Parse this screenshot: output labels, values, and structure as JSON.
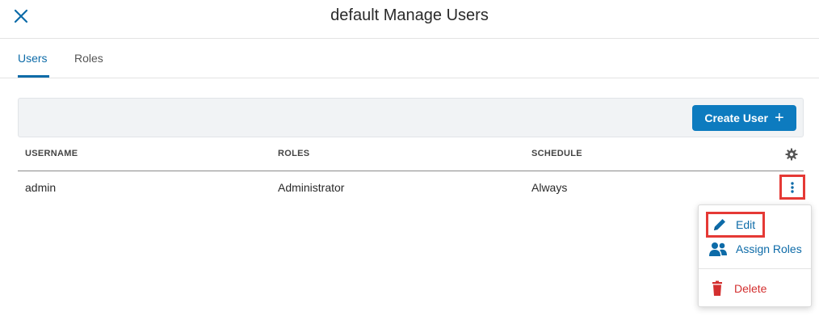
{
  "header": {
    "title": "default Manage Users",
    "close_icon": "close-icon"
  },
  "tabs": [
    {
      "label": "Users",
      "active": true
    },
    {
      "label": "Roles",
      "active": false
    }
  ],
  "toolbar": {
    "create_user_label": "Create User",
    "create_user_icon": "plus-icon"
  },
  "table": {
    "columns": [
      "USERNAME",
      "ROLES",
      "SCHEDULE"
    ],
    "settings_icon": "gear-icon",
    "rows": [
      {
        "username": "admin",
        "roles": "Administrator",
        "schedule": "Always"
      }
    ]
  },
  "row_menu": {
    "items": [
      {
        "label": "Edit",
        "icon": "pencil-icon"
      },
      {
        "label": "Assign Roles",
        "icon": "users-icon"
      },
      {
        "label": "Delete",
        "icon": "trash-icon"
      }
    ]
  },
  "colors": {
    "accent": "#0d6ba8",
    "button": "#0d7bbf",
    "danger": "#d32f2f",
    "highlight": "#e53935"
  }
}
